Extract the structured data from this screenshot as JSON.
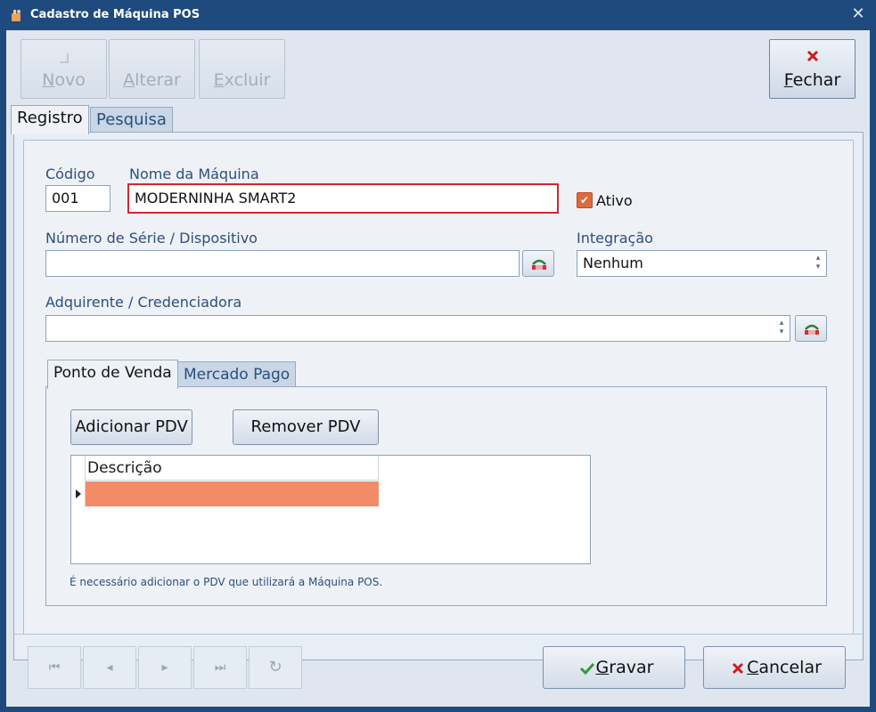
{
  "window": {
    "title": "Cadastro de Máquina POS",
    "close": "✕"
  },
  "toolbar": {
    "novo": {
      "mnemonic": "N",
      "rest": "ovo",
      "icon": "new-icon"
    },
    "alterar": {
      "mnemonic": "A",
      "rest": "lterar"
    },
    "excluir": {
      "mnemonic": "E",
      "rest": "xcluir"
    },
    "fechar": {
      "mnemonic": "F",
      "rest": "echar",
      "icon": "close-x-icon"
    }
  },
  "tabs": [
    "Registro",
    "Pesquisa"
  ],
  "form": {
    "codigo_label": "Código",
    "codigo_value": "001",
    "nome_label": "Nome da Máquina",
    "nome_value": "MODERNINHA SMART2",
    "ativo_label": "Ativo",
    "serie_label": "Número de Série / Dispositivo",
    "serie_value": "",
    "integracao_label": "Integração",
    "integracao_value": "Nenhum",
    "adquirente_label": "Adquirente / Credenciadora",
    "adquirente_value": ""
  },
  "subtabs": [
    "Ponto de Venda",
    "Mercado Pago"
  ],
  "pdv": {
    "add_label": "Adicionar PDV",
    "remove_label": "Remover PDV",
    "grid_header": "Descrição",
    "hint": "É necessário adicionar o PDV que utilizará a Máquina POS."
  },
  "footer": {
    "gravar": {
      "mnemonic": "G",
      "rest": "ravar"
    },
    "cancelar": {
      "mnemonic": "C",
      "rest": "ancelar"
    }
  },
  "colors": {
    "accent": "#1f4a7d",
    "highlight_row": "#f38c66",
    "focus_border": "#d9232f",
    "checkbox": "#e0683f"
  }
}
